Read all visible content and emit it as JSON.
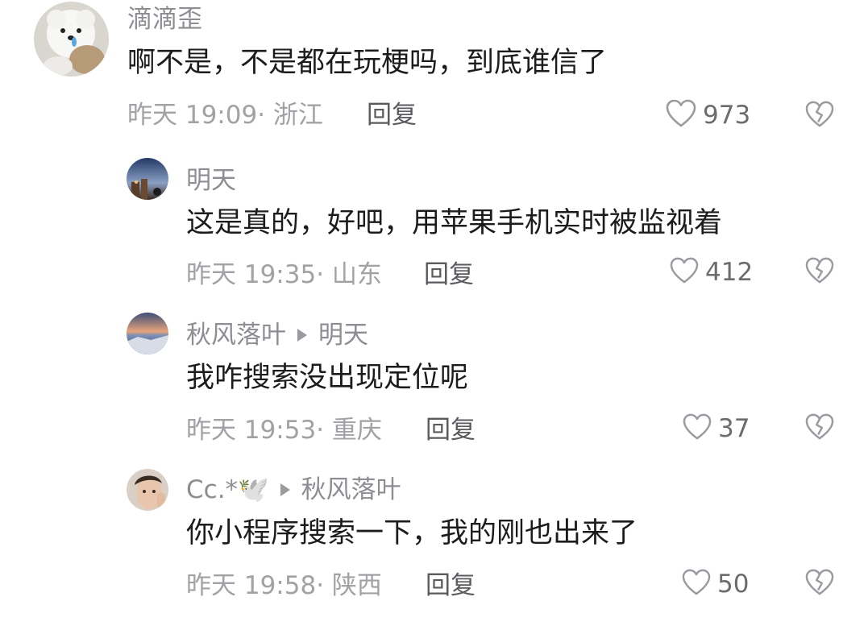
{
  "comments": [
    {
      "username": "滴滴歪",
      "text": "啊不是，不是都在玩梗吗，到底谁信了",
      "time": "昨天 19:09",
      "location": "· 浙江",
      "reply_label": "回复",
      "likes": "973"
    },
    {
      "username": "明天",
      "text": "这是真的，好吧，用苹果手机实时被监视着",
      "time": "昨天 19:35",
      "location": "· 山东",
      "reply_label": "回复",
      "likes": "412"
    },
    {
      "username": "秋风落叶",
      "reply_to": "明天",
      "text": "我咋搜索没出现定位呢",
      "time": "昨天 19:53",
      "location": "· 重庆",
      "reply_label": "回复",
      "likes": "37"
    },
    {
      "username": "Cc.*🕊️",
      "reply_to": "秋风落叶",
      "text": "你小程序搜索一下，我的刚也出来了",
      "time": "昨天 19:58",
      "location": "· 陕西",
      "reply_label": "回复",
      "likes": "50"
    }
  ],
  "colors": {
    "username": "#8d8d93",
    "text": "#1c1c1e",
    "meta": "#a1a1a6",
    "icon": "#9a9aa0"
  },
  "icons": [
    "heart-icon",
    "broken-heart-icon",
    "reply-arrow-icon"
  ]
}
